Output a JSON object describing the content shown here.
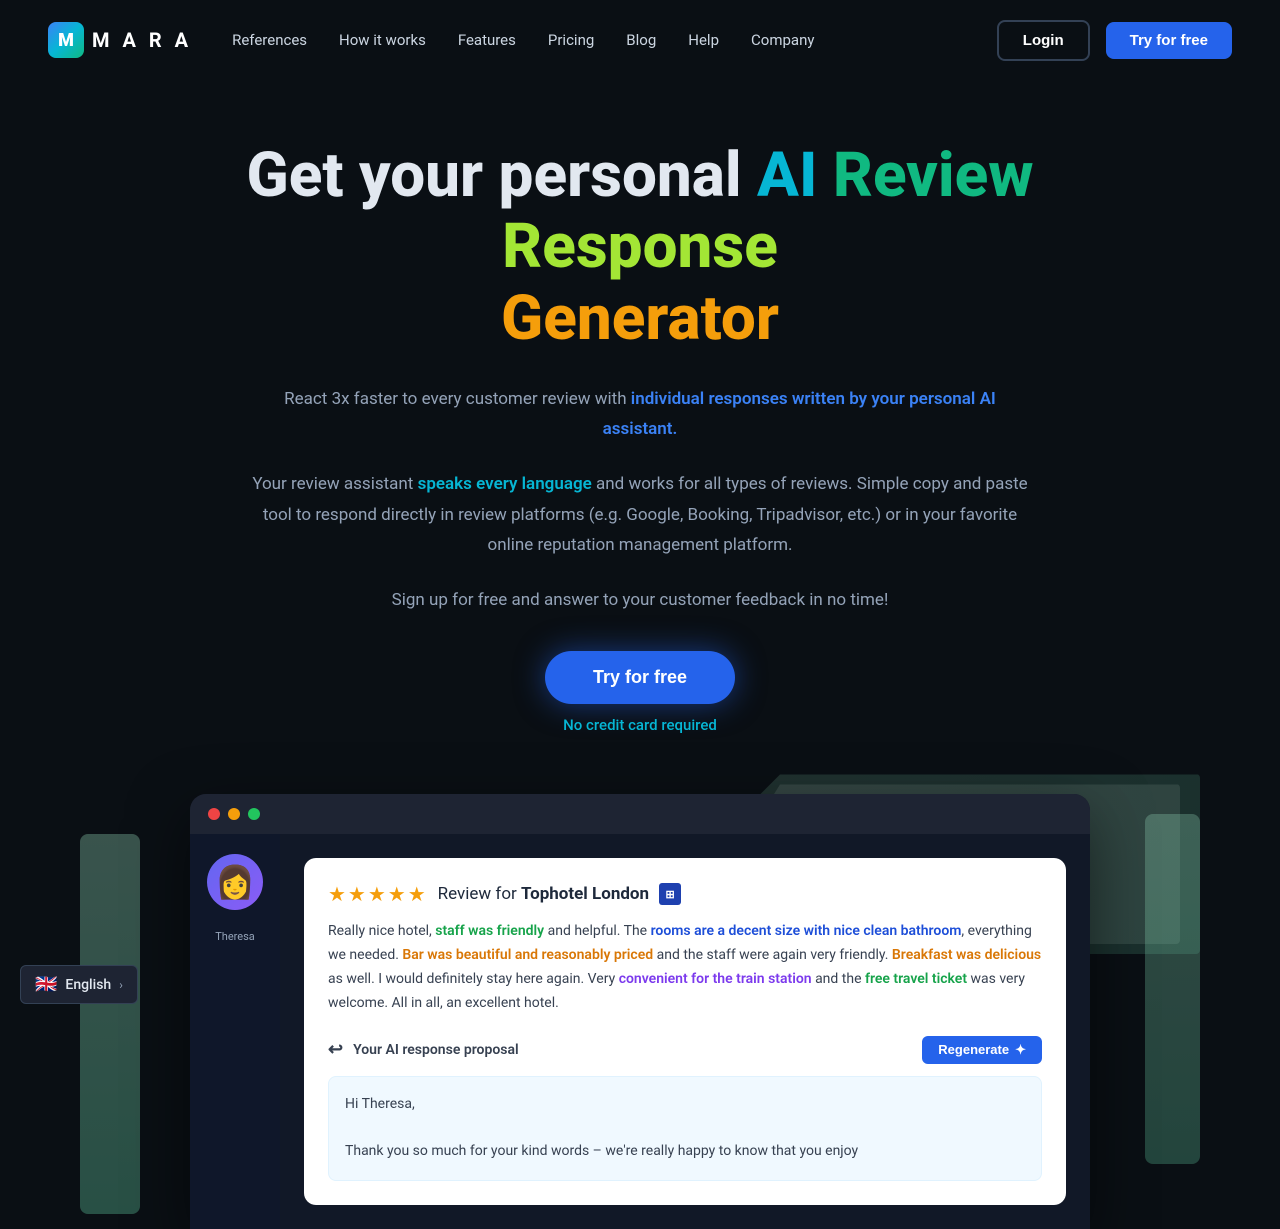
{
  "nav": {
    "logo_text": "M A R A",
    "links": [
      {
        "label": "References",
        "id": "references"
      },
      {
        "label": "How it works",
        "id": "how-it-works"
      },
      {
        "label": "Features",
        "id": "features"
      },
      {
        "label": "Pricing",
        "id": "pricing"
      },
      {
        "label": "Blog",
        "id": "blog"
      },
      {
        "label": "Help",
        "id": "help"
      },
      {
        "label": "Company",
        "id": "company"
      }
    ],
    "login_label": "Login",
    "try_label": "Try for free"
  },
  "hero": {
    "title_part1": "Get your personal ",
    "title_ai": "AI ",
    "title_review": "Review ",
    "title_response": "Response",
    "title_generator": "Generator",
    "desc1": "React 3x faster to every customer review with ",
    "desc1_highlight": "individual responses written by your personal AI assistant.",
    "desc2": "Your review assistant ",
    "desc2_highlight": "speaks every language",
    "desc2_rest": " and works for all types of reviews. Simple copy and paste tool to respond directly in review platforms (e.g. Google, Booking, Tripadvisor, etc.) or in your favorite online reputation management platform.",
    "desc3": "Sign up for free and answer to your customer feedback in no time!",
    "cta_label": "Try for free",
    "no_cc_label": "No credit card required"
  },
  "demo": {
    "window_dots": [
      "red",
      "yellow",
      "green"
    ],
    "reviewer_name": "Theresa",
    "review_stars": "★★★★★",
    "review_for": "Review for ",
    "hotel_name": "Tophotel London",
    "review_text_1": "Really nice hotel, ",
    "review_hl1": "staff was friendly",
    "review_text_2": " and helpful. The ",
    "review_hl2": "rooms are a decent size with nice clean bathroom",
    "review_text_3": ", everything we needed. ",
    "review_hl3": "Bar was beautiful and reasonably priced",
    "review_text_4": " and the staff were again very friendly. ",
    "review_hl4": "Breakfast was delicious",
    "review_text_5": " as well. I would definitely stay here again. Very ",
    "review_hl5": "convenient for the train station",
    "review_text_6": " and the ",
    "review_hl6": "free travel ticket",
    "review_text_7": " was very welcome. All in all, an excellent hotel.",
    "ai_response_label": "Your AI response proposal",
    "regenerate_label": "Regenerate",
    "ai_response_line1": "Hi Theresa,",
    "ai_response_line2": "Thank you so much for your kind words – we're really happy to know that you enjoy"
  },
  "footer": {
    "lang_flag": "🇬🇧",
    "lang_text": "English",
    "lang_chevron": "›"
  }
}
